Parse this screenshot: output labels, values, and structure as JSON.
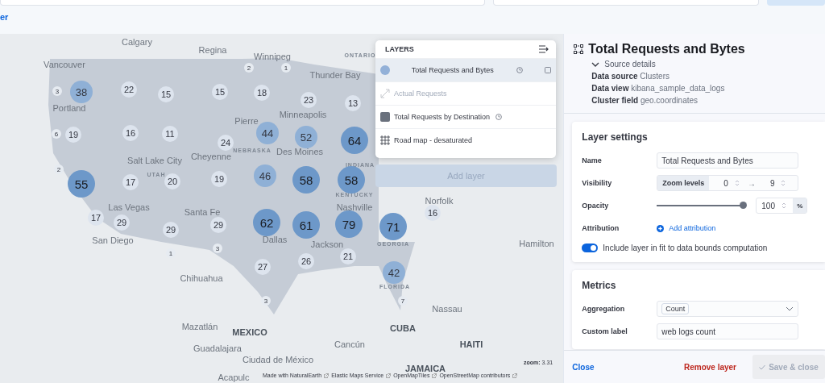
{
  "top_bar": {
    "link": "er"
  },
  "map": {
    "places": [
      {
        "name": "Calgary",
        "kind": "city"
      },
      {
        "name": "Regina",
        "kind": "city"
      },
      {
        "name": "Winnipeg",
        "kind": "city"
      },
      {
        "name": "ONTARIO",
        "kind": "region"
      },
      {
        "name": "Vancouver",
        "kind": "city"
      },
      {
        "name": "Thunder Bay",
        "kind": "city"
      },
      {
        "name": "Portland",
        "kind": "city"
      },
      {
        "name": "Minneapolis",
        "kind": "city"
      },
      {
        "name": "Pierre",
        "kind": "city"
      },
      {
        "name": "NEBRASKA",
        "kind": "region"
      },
      {
        "name": "Des Moines",
        "kind": "city"
      },
      {
        "name": "INDIANA",
        "kind": "region"
      },
      {
        "name": "Salt Lake City",
        "kind": "city"
      },
      {
        "name": "UTAH",
        "kind": "region"
      },
      {
        "name": "Cheyenne",
        "kind": "city"
      },
      {
        "name": "KENTUCKY",
        "kind": "region"
      },
      {
        "name": "Nashville",
        "kind": "city"
      },
      {
        "name": "Norfolk",
        "kind": "city"
      },
      {
        "name": "Las Vegas",
        "kind": "city"
      },
      {
        "name": "Santa Fe",
        "kind": "city"
      },
      {
        "name": "San Diego",
        "kind": "city"
      },
      {
        "name": "Dallas",
        "kind": "city"
      },
      {
        "name": "Jackson",
        "kind": "city"
      },
      {
        "name": "GEORGIA",
        "kind": "region"
      },
      {
        "name": "Hamilton",
        "kind": "city"
      },
      {
        "name": "Chihuahua",
        "kind": "city"
      },
      {
        "name": "FLORIDA",
        "kind": "region"
      },
      {
        "name": "Nassau",
        "kind": "city"
      },
      {
        "name": "Mazatlán",
        "kind": "city"
      },
      {
        "name": "MEXICO",
        "kind": "country"
      },
      {
        "name": "CUBA",
        "kind": "country"
      },
      {
        "name": "Guadalajara",
        "kind": "city"
      },
      {
        "name": "Cancún",
        "kind": "city"
      },
      {
        "name": "Ciudad de México",
        "kind": "city"
      },
      {
        "name": "HAITI",
        "kind": "country"
      },
      {
        "name": "JAMAICA",
        "kind": "country"
      },
      {
        "name": "Acapulc",
        "kind": "city"
      }
    ],
    "clusters": [
      {
        "count": "3",
        "kind": "tiny"
      },
      {
        "count": "38",
        "kind": "medium"
      },
      {
        "count": "22",
        "kind": "small"
      },
      {
        "count": "15",
        "kind": "small"
      },
      {
        "count": "15",
        "kind": "small"
      },
      {
        "count": "18",
        "kind": "small"
      },
      {
        "count": "23",
        "kind": "small"
      },
      {
        "count": "13",
        "kind": "small"
      },
      {
        "count": "2",
        "kind": "tiny"
      },
      {
        "count": "1",
        "kind": "tiny"
      },
      {
        "count": "6",
        "kind": "tiny"
      },
      {
        "count": "19",
        "kind": "small"
      },
      {
        "count": "16",
        "kind": "small"
      },
      {
        "count": "11",
        "kind": "small"
      },
      {
        "count": "24",
        "kind": "small"
      },
      {
        "count": "44",
        "kind": "medium"
      },
      {
        "count": "52",
        "kind": "medium"
      },
      {
        "count": "64",
        "kind": "large"
      },
      {
        "count": "2",
        "kind": "tiny"
      },
      {
        "count": "55",
        "kind": "large"
      },
      {
        "count": "17",
        "kind": "small"
      },
      {
        "count": "20",
        "kind": "small"
      },
      {
        "count": "19",
        "kind": "small"
      },
      {
        "count": "46",
        "kind": "medium"
      },
      {
        "count": "58",
        "kind": "large"
      },
      {
        "count": "58",
        "kind": "large"
      },
      {
        "count": "17",
        "kind": "small"
      },
      {
        "count": "29",
        "kind": "small"
      },
      {
        "count": "29",
        "kind": "small"
      },
      {
        "count": "29",
        "kind": "small"
      },
      {
        "count": "62",
        "kind": "large"
      },
      {
        "count": "61",
        "kind": "large"
      },
      {
        "count": "79",
        "kind": "large"
      },
      {
        "count": "71",
        "kind": "large"
      },
      {
        "count": "42",
        "kind": "medium"
      },
      {
        "count": "16",
        "kind": "small"
      },
      {
        "count": "1",
        "kind": "tiny"
      },
      {
        "count": "3",
        "kind": "tiny"
      },
      {
        "count": "27",
        "kind": "small"
      },
      {
        "count": "26",
        "kind": "small"
      },
      {
        "count": "21",
        "kind": "small"
      },
      {
        "count": "7",
        "kind": "tiny"
      },
      {
        "count": "3",
        "kind": "tiny"
      }
    ],
    "zoom_label": "zoom:",
    "zoom_value": "3.31",
    "attributions": [
      "Made with NaturalEarth",
      "Elastic Maps Service",
      "OpenMapTiles",
      "OpenStreetMap contributors"
    ]
  },
  "layers_panel": {
    "title": "LAYERS",
    "items": [
      {
        "label": "Total Requests and Bytes",
        "kind": "circle",
        "selected": true,
        "disabled": false,
        "time_icon": true,
        "mask_icon": true
      },
      {
        "label": "Actual Requests",
        "kind": "line",
        "selected": false,
        "disabled": true,
        "time_icon": false,
        "mask_icon": false
      },
      {
        "label": "Total Requests by Destination",
        "kind": "square",
        "selected": false,
        "disabled": false,
        "time_icon": true,
        "mask_icon": false
      },
      {
        "label": "Road map - desaturated",
        "kind": "grid",
        "selected": false,
        "disabled": false,
        "time_icon": false,
        "mask_icon": false
      }
    ],
    "add_button": {
      "label": "Add layer",
      "disabled": true
    }
  },
  "editor": {
    "title": "Total Requests and Bytes",
    "source_toggle": {
      "label": "Source details",
      "expanded": true
    },
    "details": [
      {
        "label": "Data source",
        "value": "Clusters"
      },
      {
        "label": "Data view",
        "value": "kibana_sample_data_logs"
      },
      {
        "label": "Cluster field",
        "value": "geo.coordinates"
      }
    ],
    "layer_settings": {
      "title": "Layer settings",
      "name_label": "Name",
      "name_value": "Total Requests and Bytes",
      "visibility_label": "Visibility",
      "zoom_label": "Zoom levels",
      "zoom_min": "0",
      "zoom_arrow": "→",
      "zoom_max": "9",
      "opacity_label": "Opacity",
      "opacity": {
        "level": 1
      },
      "opacity_value": "100",
      "opacity_unit": "%",
      "attribution_label": "Attribution",
      "attribution_link": "Add attribution",
      "fit_toggle": {
        "label": "Include layer in fit to data bounds computation",
        "on": true
      }
    },
    "metrics": {
      "title": "Metrics",
      "aggregation_label": "Aggregation",
      "aggregation_value": "Count",
      "custom_label_label": "Custom label",
      "custom_label_value": "web logs count"
    },
    "footer": {
      "close": "Close",
      "remove": "Remove layer",
      "save": "Save & close",
      "save_disabled": true
    }
  }
}
